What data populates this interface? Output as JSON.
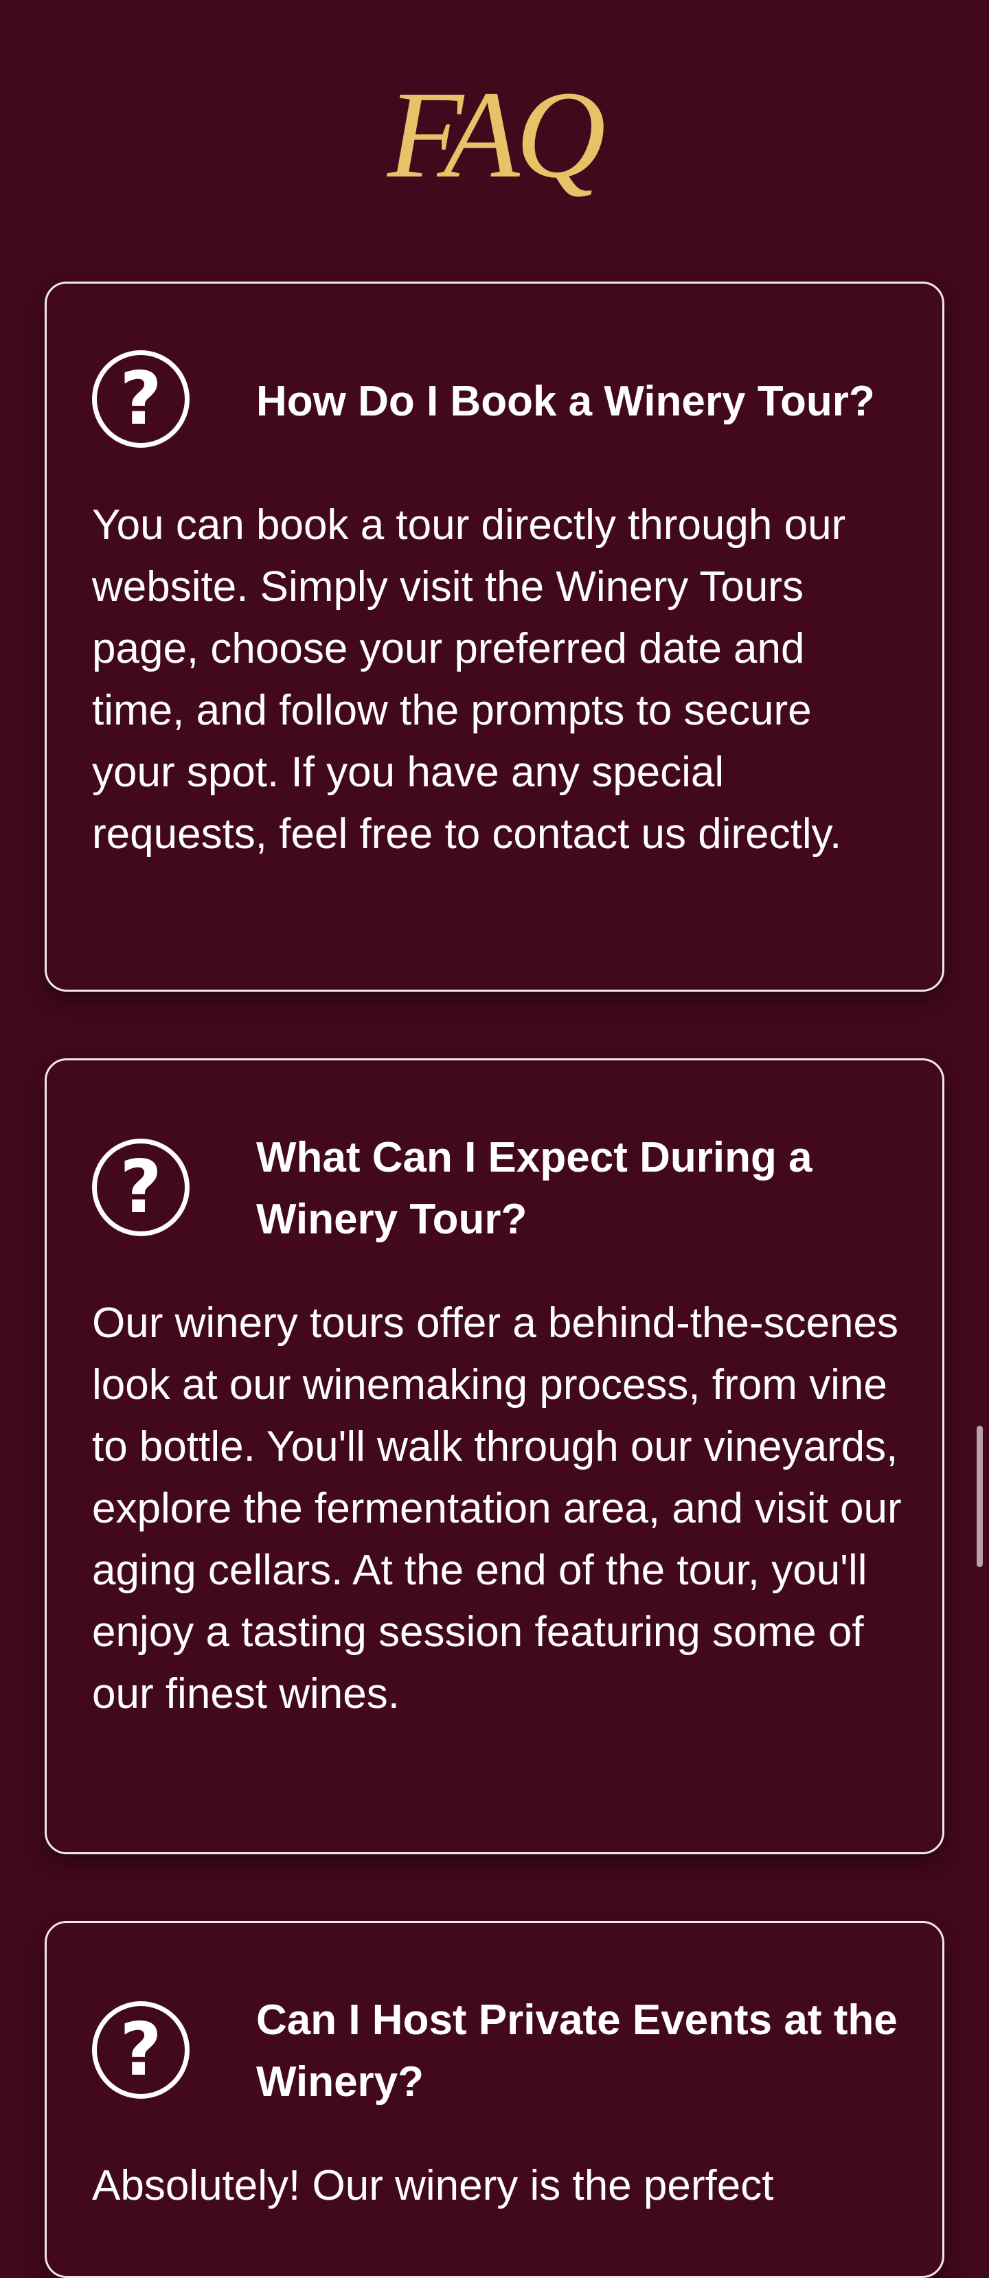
{
  "page": {
    "title": "FAQ"
  },
  "colors": {
    "background": "#42081c",
    "title_gold": "#e8c268",
    "card_border": "#f2e7ea",
    "text": "#ffffff"
  },
  "faq": [
    {
      "icon": "question-circle-icon",
      "icon_glyph": "?",
      "question": "How Do I Book a Winery Tour?",
      "answer": "You can book a tour directly through our website. Simply visit the Winery Tours page, choose your preferred date and time, and follow the prompts to secure your spot. If you have any special requests, feel free to contact us directly."
    },
    {
      "icon": "question-circle-icon",
      "icon_glyph": "?",
      "question": "What Can I Expect During a Winery Tour?",
      "answer": "Our winery tours offer a behind-the-scenes look at our winemaking process, from vine to bottle. You'll walk through our vineyards, explore the fermentation area, and visit our aging cellars. At the end of the tour, you'll enjoy a tasting session featuring some of our finest wines."
    },
    {
      "icon": "question-circle-icon",
      "icon_glyph": "?",
      "question": "Can I Host Private Events at the Winery?",
      "answer": "Absolutely! Our winery is the perfect"
    }
  ]
}
